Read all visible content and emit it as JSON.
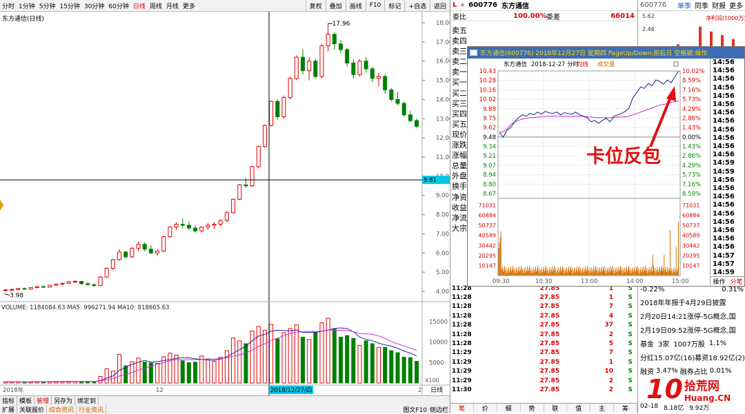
{
  "toolbar": {
    "periods": [
      "分时",
      "1分钟",
      "5分钟",
      "15分钟",
      "30分钟",
      "60分钟",
      "日线",
      "周线",
      "月线",
      "更多"
    ],
    "active_period": "日线",
    "buttons": [
      "复权",
      "叠加",
      "画线",
      "F10",
      "标记",
      "+自选",
      "返回"
    ]
  },
  "kline": {
    "title": "东方通信(日线)",
    "price_axis": [
      "18.00",
      "17.00",
      "16.00",
      "15.00",
      "14.00",
      "13.00",
      "12.00",
      "11.00",
      "10.00",
      "9.00",
      "8.00",
      "7.00",
      "6.00",
      "5.00",
      "4.00"
    ],
    "high_label": "17.96",
    "low_label": "3.98",
    "cross_price": "9.81",
    "candles": [
      [
        4.05,
        4.12,
        3.98,
        4.08
      ],
      [
        4.08,
        4.15,
        4.02,
        4.1
      ],
      [
        4.1,
        4.18,
        4.05,
        4.15
      ],
      [
        4.15,
        4.2,
        4.08,
        4.12
      ],
      [
        4.12,
        4.22,
        4.1,
        4.2
      ],
      [
        4.2,
        4.28,
        4.15,
        4.25
      ],
      [
        4.25,
        4.3,
        4.18,
        4.22
      ],
      [
        4.22,
        4.35,
        4.2,
        4.32
      ],
      [
        4.32,
        4.4,
        4.28,
        4.38
      ],
      [
        4.38,
        4.45,
        4.3,
        4.42
      ],
      [
        4.42,
        4.55,
        4.38,
        4.5
      ],
      [
        4.5,
        4.58,
        4.45,
        4.52
      ],
      [
        4.52,
        4.55,
        4.35,
        4.4
      ],
      [
        4.4,
        4.48,
        4.3,
        4.35
      ],
      [
        4.35,
        4.42,
        4.25,
        4.3
      ],
      [
        4.3,
        4.8,
        4.28,
        4.75
      ],
      [
        4.75,
        5.25,
        4.7,
        5.2
      ],
      [
        5.2,
        5.7,
        5.1,
        5.65
      ],
      [
        5.65,
        6.2,
        5.6,
        6.05
      ],
      [
        6.05,
        6.1,
        5.7,
        5.8
      ],
      [
        5.8,
        6.3,
        5.75,
        6.25
      ],
      [
        6.25,
        6.6,
        6.1,
        6.45
      ],
      [
        6.45,
        6.55,
        6.1,
        6.2
      ],
      [
        6.2,
        6.4,
        5.95,
        6.0
      ],
      [
        6.0,
        6.2,
        5.85,
        6.1
      ],
      [
        6.1,
        6.9,
        6.05,
        6.85
      ],
      [
        6.85,
        7.4,
        6.8,
        7.35
      ],
      [
        7.35,
        7.6,
        7.2,
        7.5
      ],
      [
        7.5,
        7.8,
        7.3,
        7.45
      ],
      [
        7.45,
        7.65,
        7.2,
        7.3
      ],
      [
        7.3,
        7.45,
        7.05,
        7.15
      ],
      [
        7.15,
        7.4,
        7.05,
        7.35
      ],
      [
        7.35,
        7.55,
        7.2,
        7.45
      ],
      [
        7.45,
        7.6,
        7.25,
        7.5
      ],
      [
        7.5,
        7.75,
        7.4,
        7.7
      ],
      [
        7.7,
        8.2,
        7.6,
        8.1
      ],
      [
        8.1,
        8.85,
        8.05,
        8.8
      ],
      [
        8.8,
        9.6,
        8.75,
        9.55
      ],
      [
        9.55,
        9.9,
        9.4,
        9.5
      ],
      [
        9.5,
        10.55,
        9.45,
        10.5
      ],
      [
        10.5,
        11.6,
        10.4,
        11.55
      ],
      [
        11.55,
        12.7,
        11.5,
        12.65
      ],
      [
        12.65,
        13.95,
        12.6,
        13.9
      ],
      [
        13.9,
        14.0,
        12.95,
        13.1
      ],
      [
        13.1,
        14.2,
        13.0,
        14.1
      ],
      [
        14.1,
        15.2,
        14.0,
        15.1
      ],
      [
        15.1,
        16.3,
        15.0,
        16.2
      ],
      [
        16.2,
        16.6,
        15.3,
        15.5
      ],
      [
        15.5,
        16.2,
        15.0,
        16.0
      ],
      [
        16.0,
        16.1,
        15.1,
        15.2
      ],
      [
        15.2,
        16.9,
        15.1,
        16.8
      ],
      [
        16.8,
        17.96,
        16.5,
        17.4
      ],
      [
        17.4,
        17.5,
        16.6,
        16.9
      ],
      [
        16.9,
        17.1,
        16.4,
        16.6
      ],
      [
        16.6,
        16.7,
        15.7,
        15.9
      ],
      [
        15.9,
        16.1,
        15.1,
        15.3
      ],
      [
        15.3,
        16.1,
        15.2,
        16.0
      ],
      [
        16.0,
        16.2,
        15.4,
        15.6
      ],
      [
        15.6,
        15.7,
        14.9,
        15.1
      ],
      [
        15.1,
        15.4,
        14.7,
        15.2
      ],
      [
        15.2,
        15.3,
        14.3,
        14.5
      ],
      [
        14.5,
        14.6,
        13.9,
        14.0
      ],
      [
        14.0,
        14.4,
        13.7,
        13.8
      ],
      [
        13.8,
        13.9,
        13.1,
        13.2
      ],
      [
        13.2,
        13.4,
        12.8,
        12.9
      ],
      [
        12.9,
        13.0,
        12.5,
        12.6
      ]
    ],
    "volume_title": "VOLUME: 1184084.63 MA5: 996271.94 MA10: 818665.63",
    "volume_axis": [
      "15000",
      "10000",
      "5000"
    ],
    "volume_unit": "X100",
    "volumes": [
      300,
      250,
      280,
      260,
      300,
      320,
      280,
      350,
      380,
      400,
      420,
      380,
      350,
      300,
      320,
      1600,
      3500,
      2900,
      7000,
      4200,
      5200,
      6100,
      5100,
      4900,
      4800,
      6400,
      7300,
      6800,
      5400,
      5000,
      5100,
      6600,
      5900,
      5300,
      6300,
      7900,
      11000,
      10300,
      9600,
      12700,
      13800,
      12900,
      14300,
      10800,
      12300,
      13300,
      14200,
      11200,
      10600,
      12400,
      14700,
      15800,
      13200,
      11200,
      11600,
      10900,
      9200,
      10300,
      9600,
      8700,
      8700,
      7900,
      7400,
      6300,
      6200,
      5300
    ],
    "date_labels": [
      "2018年",
      "12",
      "2018/12/27/四",
      "2"
    ],
    "side_label": "日线"
  },
  "quote": {
    "flag": "L",
    "code": "600776",
    "name": "东方通信",
    "weibi_label": "委比",
    "weibi_value": "100.00%",
    "weicha_label": "委差",
    "weicha_value": "66014",
    "left_labels": [
      "卖五",
      "卖四",
      "卖三",
      "卖二",
      "卖一",
      "买一",
      "买二",
      "买三",
      "买四",
      "买五",
      "现价",
      "涨跌",
      "涨幅",
      "总量",
      "外盘",
      "换手",
      "净资",
      "收益",
      "净流",
      "大宗"
    ],
    "ticks": [
      [
        "11:28",
        "27.85",
        "1",
        "S"
      ],
      [
        "11:28",
        "27.85",
        "1",
        "S"
      ],
      [
        "11:28",
        "27.85",
        "7",
        "S"
      ],
      [
        "11:28",
        "27.85",
        "4",
        "S"
      ],
      [
        "11:28",
        "27.85",
        "37",
        "S"
      ],
      [
        "11:28",
        "27.85",
        "2",
        "S"
      ],
      [
        "11:28",
        "27.85",
        "5",
        "S"
      ],
      [
        "11:29",
        "27.85",
        "7",
        "S"
      ],
      [
        "11:29",
        "27.85",
        "1",
        "S"
      ],
      [
        "11:29",
        "27.85",
        "10",
        "S"
      ],
      [
        "11:29",
        "27.85",
        "2",
        "S"
      ],
      [
        "11:30",
        "27.85",
        "2",
        "S"
      ]
    ],
    "bottom_tabs": [
      "笔",
      "价",
      "细",
      "势",
      "联",
      "值",
      "主",
      "筹"
    ],
    "active_tab": "笔"
  },
  "popup": {
    "title": "东方通信(600776)  2018年12月27日  星期四  PageUp/Down:前后日  空格键:操作",
    "chart_name": "东方通信",
    "chart_date": "2018-12-27 分时",
    "legend_avg": "均线",
    "legend_vol": "成交量",
    "price_left": [
      "10.43",
      "10.28",
      "10.16",
      "10.02",
      "9.89",
      "9.75",
      "9.62",
      "9.48",
      "9.34",
      "9.21",
      "9.07",
      "8.94",
      "8.80",
      "8.67"
    ],
    "price_right": [
      "10.02%",
      "8.59%",
      "7.16%",
      "5.73%",
      "4.29%",
      "2.86%",
      "1.43%",
      "0.00%",
      "1.43%",
      "2.86%",
      "4.29%",
      "5.73%",
      "7.16%",
      "8.59%"
    ],
    "vol_axis": [
      "71031",
      "60884",
      "50737",
      "40589",
      "30442",
      "20295",
      "10147"
    ],
    "time_axis": [
      "09:30",
      "10:30",
      "13:00",
      "14:00",
      "15:00"
    ],
    "annotation": "卡位反包",
    "side_times": [
      "14:56",
      "14:56",
      "14:56",
      "14:56",
      "14:56",
      "14:56",
      "14:56",
      "14:56",
      "14:56",
      "14:56",
      "14:56",
      "14:56",
      "14:59",
      "14:59",
      "14:56",
      "14:56",
      "14:56",
      "14:56",
      "14:56",
      "14:56",
      "14:56",
      "14:56",
      "14:56",
      "14:57",
      "14:57",
      "14:59"
    ],
    "op_label": "操作",
    "fenbi_label": "分笔",
    "price_series": [
      9.55,
      9.48,
      9.58,
      9.62,
      9.7,
      9.76,
      9.8,
      9.78,
      9.82,
      9.8,
      9.84,
      9.81,
      9.85,
      9.83,
      9.82,
      9.84,
      9.8,
      9.83,
      9.82,
      9.81,
      9.84,
      9.8,
      9.78,
      9.76,
      9.7,
      9.72,
      9.68,
      9.72,
      9.75,
      9.7,
      9.78,
      9.8,
      9.82,
      9.85,
      9.9,
      10.05,
      10.12,
      10.2,
      10.18,
      10.25,
      10.22,
      10.3,
      10.28,
      10.24,
      10.3,
      10.26,
      10.35,
      10.43
    ],
    "avg_series": [
      9.55,
      9.56,
      9.6,
      9.66,
      9.7,
      9.72,
      9.74,
      9.75,
      9.76,
      9.76,
      9.77,
      9.77,
      9.78,
      9.78,
      9.78,
      9.78,
      9.78,
      9.78,
      9.78,
      9.78,
      9.78,
      9.78,
      9.78,
      9.77,
      9.77,
      9.76,
      9.76,
      9.76,
      9.76,
      9.76,
      9.76,
      9.77,
      9.77,
      9.77,
      9.78,
      9.8,
      9.82,
      9.84,
      9.86,
      9.88,
      9.9,
      9.92,
      9.94,
      9.95,
      9.96,
      9.98,
      9.99,
      10.0
    ]
  },
  "finance": {
    "code": "600776",
    "tabs": [
      "单季",
      "同季",
      "财报",
      "更多"
    ],
    "active_tab": "单季",
    "axis": [
      "5.62",
      "2.46"
    ],
    "chart_label": "净利润(1000万)",
    "bars": [
      0.5,
      1.2,
      0.8,
      5.2,
      4.1,
      3.3,
      2.4
    ],
    "pct_change": "-0.22%",
    "pct_value": "0.31%",
    "news": [
      "2018年年报于4月29日披露",
      "2月20日14:21涨停-5G概念,国",
      "2月19日09:52涨停-5G概念,国"
    ],
    "fund_label": "基金",
    "fund_count": "3家",
    "fund_shares": "1007万股",
    "fund_pct": "1.1%",
    "div_label": "分红",
    "div_value": "15.07亿(16)",
    "raise_label": "募资",
    "raise_value": "18.92亿(2)",
    "margin_label": "融资",
    "margin_value": "3.47%",
    "short_label": "融券占比",
    "short_value": "0.01%",
    "logo_text": "拾荒网",
    "logo_sub": "Huang.CN",
    "last_rows": [
      "02-18",
      "8.18亿",
      "9.92万"
    ]
  },
  "bottombar": {
    "row1": [
      "指标",
      "模板",
      "管理",
      "另存为",
      "绑定到"
    ],
    "row1_active": "管理",
    "row2": [
      "扩展",
      "关联报价",
      "综合资讯",
      "行业资讯"
    ],
    "right": [
      "图文F10",
      "侧边栏"
    ]
  }
}
